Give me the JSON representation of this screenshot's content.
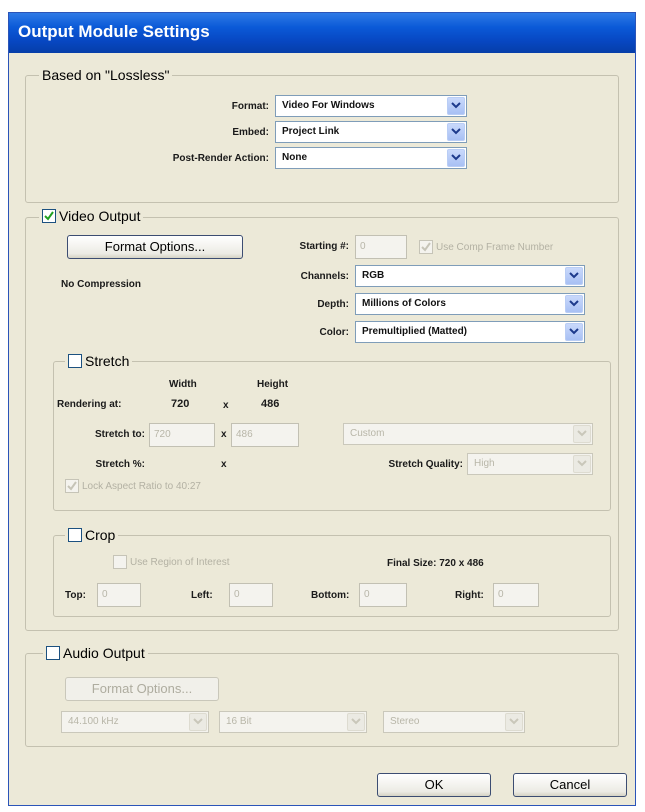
{
  "window": {
    "title": "Output Module Settings"
  },
  "based_on": {
    "legend": "Based on \"Lossless\"",
    "format_label": "Format:",
    "format_value": "Video For Windows",
    "embed_label": "Embed:",
    "embed_value": "Project Link",
    "post_render_label": "Post-Render Action:",
    "post_render_value": "None"
  },
  "video": {
    "legend": "Video Output",
    "checked": true,
    "format_options_label": "Format Options...",
    "compression_text": "No Compression",
    "starting_label": "Starting #:",
    "starting_value": "0",
    "use_comp_frame_label": "Use Comp Frame Number",
    "channels_label": "Channels:",
    "channels_value": "RGB",
    "depth_label": "Depth:",
    "depth_value": "Millions of Colors",
    "color_label": "Color:",
    "color_value": "Premultiplied (Matted)"
  },
  "stretch": {
    "legend": "Stretch",
    "checked": false,
    "width_header": "Width",
    "height_header": "Height",
    "rendering_label": "Rendering at:",
    "rendering_width": "720",
    "times": "x",
    "rendering_height": "486",
    "stretch_to_label": "Stretch to:",
    "stretch_width": "720",
    "stretch_height": "486",
    "preset_value": "Custom",
    "stretch_pct_label": "Stretch %:",
    "quality_label": "Stretch Quality:",
    "quality_value": "High",
    "lock_aspect_label": "Lock Aspect Ratio to 40:27"
  },
  "crop": {
    "legend": "Crop",
    "checked": false,
    "use_roi_label": "Use Region of Interest",
    "final_size": "Final Size: 720 x 486",
    "top_label": "Top:",
    "top_value": "0",
    "left_label": "Left:",
    "left_value": "0",
    "bottom_label": "Bottom:",
    "bottom_value": "0",
    "right_label": "Right:",
    "right_value": "0"
  },
  "audio": {
    "legend": "Audio Output",
    "checked": false,
    "format_options_label": "Format Options...",
    "rate_value": "44.100 kHz",
    "bits_value": "16 Bit",
    "channels_value": "Stereo"
  },
  "footer": {
    "ok_label": "OK",
    "cancel_label": "Cancel"
  }
}
